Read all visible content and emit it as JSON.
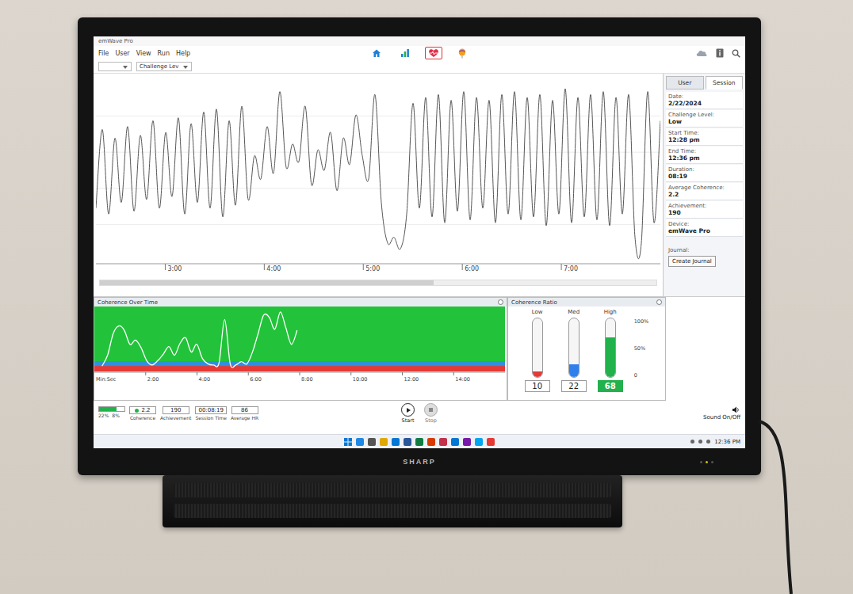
{
  "window": {
    "title": "emWave Pro"
  },
  "menu": [
    "File",
    "User",
    "View",
    "Run",
    "Help"
  ],
  "toolbar": [
    {
      "kind": "home",
      "selected": false
    },
    {
      "kind": "stats",
      "selected": false
    },
    {
      "kind": "heart",
      "selected": true
    },
    {
      "kind": "balloon",
      "selected": false
    }
  ],
  "dropdowns": [
    {
      "value": ""
    },
    {
      "value": "Challenge Lev"
    }
  ],
  "hr_chart": {
    "x_range": [
      2.3,
      8.0
    ],
    "y_range": [
      42,
      104
    ],
    "ticks": [
      {
        "label": "3:00",
        "value": 3
      },
      {
        "label": "4:00",
        "value": 4
      },
      {
        "label": "5:00",
        "value": 5
      },
      {
        "label": "6:00",
        "value": 6
      },
      {
        "label": "7:00",
        "value": 7
      }
    ],
    "values": [
      60,
      87,
      58,
      84,
      62,
      88,
      59,
      85,
      63,
      90,
      60,
      86,
      64,
      91,
      58,
      89,
      62,
      93,
      60,
      94,
      57,
      90,
      61,
      95,
      63,
      78,
      70,
      88,
      72,
      100,
      74,
      82,
      76,
      95,
      68,
      80,
      73,
      86,
      66,
      84,
      75,
      92,
      78,
      70,
      99,
      62,
      48,
      50,
      46,
      58,
      96,
      60,
      98,
      57,
      99,
      55,
      97,
      59,
      100,
      56,
      98,
      60,
      97,
      55,
      99,
      58,
      100,
      56,
      98,
      57,
      99,
      54,
      97,
      58,
      101,
      55,
      98,
      57,
      99,
      56,
      100,
      54,
      98,
      58,
      99,
      50,
      48,
      100,
      55,
      90
    ]
  },
  "side_panel": {
    "tabs": [
      {
        "label": "User",
        "selected": false
      },
      {
        "label": "Session",
        "selected": true
      }
    ],
    "fields": [
      {
        "label": "Date:",
        "value": "2/22/2024"
      },
      {
        "label": "Challenge Level:",
        "value": "Low"
      },
      {
        "label": "Start Time:",
        "value": "12:28 pm"
      },
      {
        "label": "End Time:",
        "value": "12:36 pm"
      },
      {
        "label": "Duration:",
        "value": "08:19"
      },
      {
        "label": "Average Coherence:",
        "value": "2.2"
      },
      {
        "label": "Achievement:",
        "value": "190"
      },
      {
        "label": "Device:",
        "value": "emWave Pro"
      }
    ],
    "journal_label": "Journal:",
    "journal_button": "Create Journal"
  },
  "coherence_over_time": {
    "title": "Coherence Over Time",
    "axis_title": "Min:Sec",
    "x_range": [
      0,
      16
    ],
    "y_max": 6,
    "line_range": [
      0.3,
      7.9
    ],
    "bands": [
      {
        "name": "high",
        "to": 6,
        "color": "#22c33a"
      },
      {
        "name": "medium",
        "to": 0.95,
        "color": "#2f8fe0"
      },
      {
        "name": "low",
        "to": 0.5,
        "color": "#e53935"
      }
    ],
    "ticks": [
      {
        "label": "2:00",
        "value": 2
      },
      {
        "label": "4:00",
        "value": 4
      },
      {
        "label": "6:00",
        "value": 6
      },
      {
        "label": "8:00",
        "value": 8
      },
      {
        "label": "10:00",
        "value": 10
      },
      {
        "label": "12:00",
        "value": 12
      },
      {
        "label": "14:00",
        "value": 14
      }
    ],
    "values": [
      0.5,
      1.5,
      3.5,
      4.2,
      3.8,
      2.5,
      2.9,
      2.2,
      1.0,
      0.6,
      1.0,
      1.6,
      2.3,
      1.5,
      2.6,
      3.1,
      1.8,
      2.5,
      1.2,
      0.7,
      0.6,
      0.8,
      4.8,
      0.7,
      0.6,
      0.9,
      0.7,
      1.8,
      3.5,
      5.2,
      5.0,
      3.9,
      5.5,
      4.0,
      2.5,
      3.8
    ]
  },
  "coherence_ratio": {
    "title": "Coherence Ratio",
    "scale": [
      "100%",
      "50%",
      "0"
    ],
    "items": [
      {
        "label": "Low",
        "value": "10",
        "level": 0.1,
        "color": "#e53935",
        "selected": false
      },
      {
        "label": "Med",
        "value": "22",
        "level": 0.22,
        "color": "#2f80ed",
        "selected": false
      },
      {
        "label": "High",
        "value": "68",
        "level": 0.68,
        "color": "#22b14c",
        "selected": true
      }
    ]
  },
  "status_bar": {
    "mini_meter": {
      "level": 0.7,
      "labels": [
        "22%",
        "8%"
      ]
    },
    "items": [
      {
        "value": "2.2",
        "label": "Coherence",
        "dot": true
      },
      {
        "value": "190",
        "label": "Achievement",
        "dot": false
      },
      {
        "value": "00:08:19",
        "label": "Session Time",
        "dot": false
      },
      {
        "value": "86",
        "label": "Average HR",
        "dot": false
      }
    ]
  },
  "controls": [
    {
      "label": "Start",
      "kind": "start",
      "disabled": false
    },
    {
      "label": "Stop",
      "kind": "stop",
      "disabled": true
    }
  ],
  "sound": {
    "label": "Sound On/Off"
  },
  "taskbar": {
    "icons": [
      {
        "color": "#1e88e5"
      },
      {
        "color": "#555555"
      },
      {
        "color": "#e0a800"
      },
      {
        "color": "#0078d4"
      },
      {
        "color": "#2b579a"
      },
      {
        "color": "#107c41"
      },
      {
        "color": "#d83b01"
      },
      {
        "color": "#c4314b"
      },
      {
        "color": "#0078d4"
      },
      {
        "color": "#7719aa"
      },
      {
        "color": "#00a4ef"
      },
      {
        "color": "#e53935"
      }
    ],
    "time": "12:36 PM"
  },
  "tv": {
    "brand": "SHARP"
  }
}
